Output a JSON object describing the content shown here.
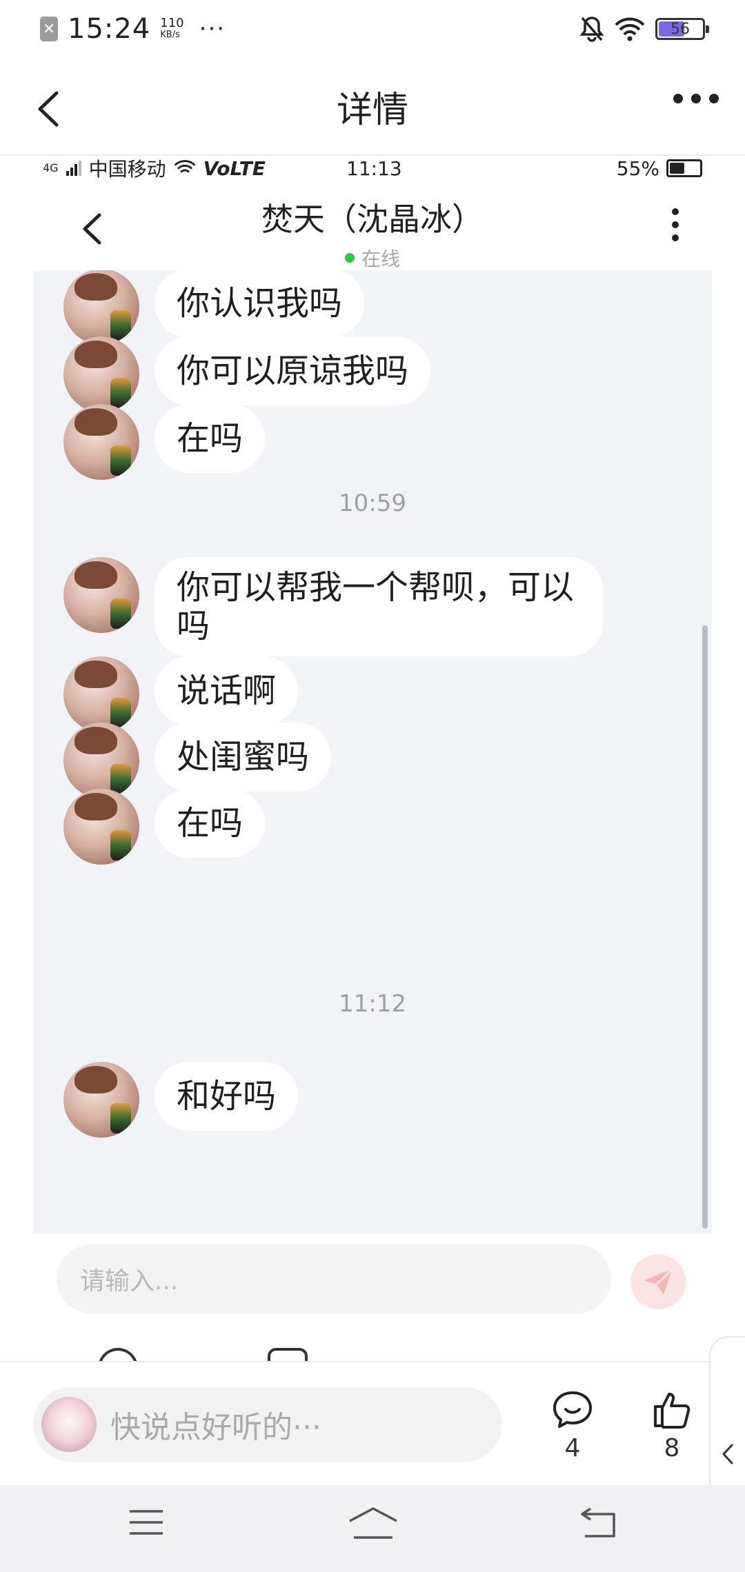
{
  "status_bar": {
    "notification_icon": "close-box-icon",
    "time": "15:24",
    "net_speed_value": "110",
    "net_speed_unit": "KB/s",
    "more_dots": "···",
    "icons": [
      "mute-bell-icon",
      "wifi-icon"
    ],
    "battery_level": "56"
  },
  "header": {
    "title": "详情",
    "back_icon": "chevron-left-icon",
    "more_icon": "more-horizontal-icon"
  },
  "screenshot": {
    "status": {
      "carrier": "中国移动",
      "network": "4G",
      "volte": "VoLTE",
      "time": "11:13",
      "battery": "55%"
    },
    "chat_header": {
      "name": "焚天（沈晶冰）",
      "status": "在线",
      "status_color": "#2dc94a"
    },
    "messages": [
      {
        "text": "你认识我吗"
      },
      {
        "text": "你可以原谅我吗"
      },
      {
        "text": "在吗"
      },
      {
        "timestamp": "10:59"
      },
      {
        "text": "你可以帮我一个帮呗，可以吗"
      },
      {
        "text": "说话啊"
      },
      {
        "text": "处闺蜜吗"
      },
      {
        "text": "在吗"
      },
      {
        "timestamp": "11:12"
      },
      {
        "text": "和好吗"
      }
    ],
    "input_placeholder": "请输入...",
    "send_icon": "paper-plane-icon"
  },
  "comment_bar": {
    "placeholder": "快说点好听的···",
    "comment_count": "4",
    "like_count": "8"
  },
  "nav_bar": {
    "buttons": [
      "menu-icon",
      "home-icon",
      "back-icon"
    ]
  },
  "colors": {
    "chat_background": "#f2f3f7",
    "bubble": "#ffffff",
    "send_button": "#fbe3e3",
    "send_icon": "#f5b5b5",
    "online_dot": "#2dc94a",
    "battery_fill": "#7b67e8"
  }
}
